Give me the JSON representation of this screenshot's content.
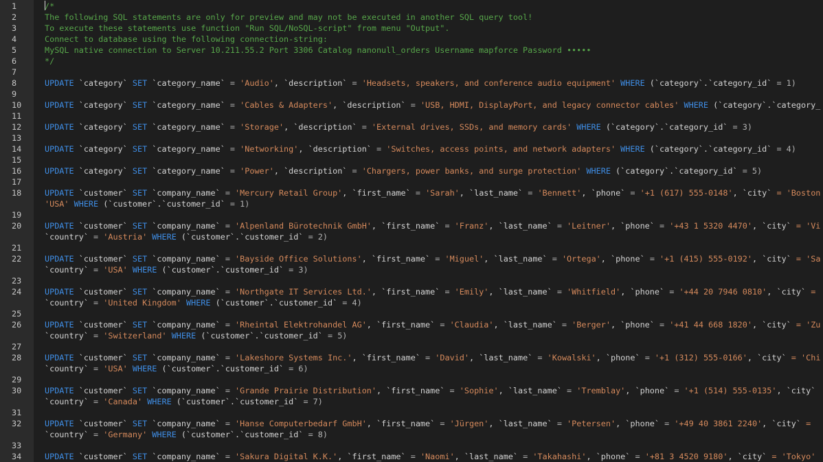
{
  "gutter": {
    "line_numbers": [
      "1",
      "2",
      "3",
      "4",
      "5",
      "6",
      "7",
      "8",
      "9",
      "10",
      "11",
      "12",
      "13",
      "14",
      "15",
      "16",
      "17",
      "18",
      "",
      "19",
      "20",
      "",
      "21",
      "22",
      "",
      "23",
      "24",
      "",
      "25",
      "26",
      "",
      "27",
      "28",
      "",
      "29",
      "30",
      "",
      "31",
      "32",
      "",
      "33",
      "34"
    ]
  },
  "editor": {
    "comment_lines": [
      "/*",
      "The following SQL statements are only for preview and may not be executed in another SQL query tool!",
      "To execute these statements use function \"Run SQL/NoSQL-script\" from menu \"Output\".",
      "Connect to database using the following connection-string:",
      "MySQL native connection to Server 10.211.55.2 Port 3306 Catalog nanonull_orders Username mapforce Password •••••",
      "*/"
    ],
    "category_updates": [
      {
        "name": "'Audio'",
        "description": "'Headsets, speakers, and conference audio equipment'",
        "where_tail": " = 1)"
      },
      {
        "name": "'Cables & Adapters'",
        "description": "'USB, HDMI, DisplayPort, and legacy connector cables'",
        "where_tail": ""
      },
      {
        "name": "'Storage'",
        "description": "'External drives, SSDs, and memory cards'",
        "where_tail": " = 3)"
      },
      {
        "name": "'Networking'",
        "description": "'Switches, access points, and network adapters'",
        "where_tail": " = 4)"
      },
      {
        "name": "'Power'",
        "description": "'Chargers, power banks, and surge protection'",
        "where_tail": " = 5)"
      }
    ],
    "customer_updates": [
      {
        "company": "'Mercury Retail Group'",
        "first": "'Sarah'",
        "last": "'Bennett'",
        "phone": "'+1 (617) 555-0148'",
        "city_tail": " = 'Boston",
        "cont_prefix": "'USA'",
        "cont_tail": " WHERE (`customer`.`customer_id` = 1)"
      },
      {
        "company": "'Alpenland Bürotechnik GmbH'",
        "first": "'Franz'",
        "last": "'Leitner'",
        "phone": "'+43 1 5320 4470'",
        "city_tail": " = 'Vi",
        "cont_prefix": "`country` = 'Austria'",
        "cont_tail": " WHERE (`customer`.`customer_id` = 2)"
      },
      {
        "company": "'Bayside Office Solutions'",
        "first": "'Miguel'",
        "last": "'Ortega'",
        "phone": "'+1 (415) 555-0192'",
        "city_tail": " = 'Sa",
        "cont_prefix": "`country` = 'USA'",
        "cont_tail": " WHERE (`customer`.`customer_id` = 3)"
      },
      {
        "company": "'Northgate IT Services Ltd.'",
        "first": "'Emily'",
        "last": "'Whitfield'",
        "phone": "'+44 20 7946 0810'",
        "city_tail": " =",
        "cont_prefix": "`country` = 'United Kingdom'",
        "cont_tail": " WHERE (`customer`.`customer_id` = 4)"
      },
      {
        "company": "'Rheintal Elektrohandel AG'",
        "first": "'Claudia'",
        "last": "'Berger'",
        "phone": "'+41 44 668 1820'",
        "city_tail": " = 'Zu",
        "cont_prefix": "`country` = 'Switzerland'",
        "cont_tail": " WHERE (`customer`.`customer_id` = 5)"
      },
      {
        "company": "'Lakeshore Systems Inc.'",
        "first": "'David'",
        "last": "'Kowalski'",
        "phone": "'+1 (312) 555-0166'",
        "city_tail": " = 'Chi",
        "cont_prefix": "`country` = 'USA'",
        "cont_tail": " WHERE (`customer`.`customer_id` = 6)"
      },
      {
        "company": "'Grande Prairie Distribution'",
        "first": "'Sophie'",
        "last": "'Tremblay'",
        "phone": "'+1 (514) 555-0135'",
        "city_tail": "",
        "cont_prefix": "`country` = 'Canada'",
        "cont_tail": " WHERE (`customer`.`customer_id` = 7)"
      },
      {
        "company": "'Hanse Computerbedarf GmbH'",
        "first": "'Jürgen'",
        "last": "'Petersen'",
        "phone": "'+49 40 3861 2240'",
        "city_tail": " =",
        "cont_prefix": "`country` = 'Germany'",
        "cont_tail": " WHERE (`customer`.`customer_id` = 8)"
      },
      {
        "company": "'Sakura Digital K.K.'",
        "first": "'Naomi'",
        "last": "'Takahashi'",
        "phone": "'+81 3 4520 9180'",
        "city_tail": " = 'Tokyo'",
        "cont_prefix": "",
        "cont_tail": ""
      }
    ]
  }
}
